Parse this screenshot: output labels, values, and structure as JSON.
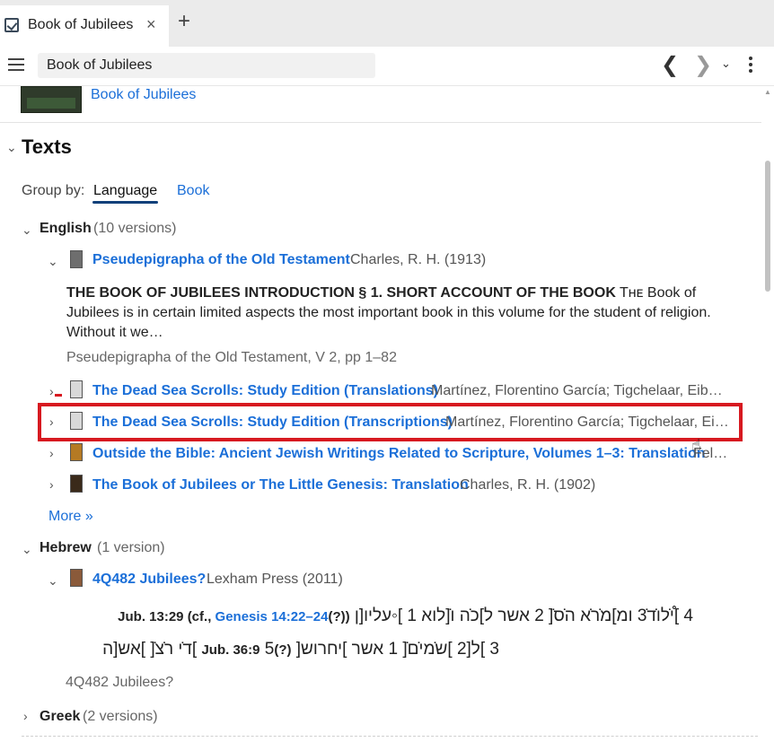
{
  "tab": {
    "title": "Book of Jubilees",
    "close": "×",
    "add": "+"
  },
  "toolbar": {
    "search_value": "Book of Jubilees",
    "back": "❮",
    "forward": "❯",
    "dropdown": "⌄"
  },
  "encyclopedia": {
    "link": "Book of Jubilees"
  },
  "texts": {
    "title": "Texts",
    "group_by_label": "Group by:",
    "group_by_options": [
      "Language",
      "Book"
    ],
    "languages": [
      {
        "name": "English",
        "count": "(10 versions)"
      },
      {
        "name": "Hebrew",
        "count": "(1 version)"
      },
      {
        "name": "Greek",
        "count": "(2 versions)"
      }
    ],
    "english_books": [
      {
        "title": "Pseudepigrapha of the Old Testament",
        "meta": "Charles, R. H. (1913)"
      },
      {
        "title": "The Dead Sea Scrolls: Study Edition (Translations)",
        "meta": "Martínez, Florentino García; Tigchelaar, Eib…"
      },
      {
        "title": "The Dead Sea Scrolls: Study Edition (Transcriptions)",
        "meta": "Martínez, Florentino García; Tigchelaar, Ei…"
      },
      {
        "title": "Outside the Bible: Ancient Jewish Writings Related to Scripture, Volumes 1–3: Translation",
        "meta": "Fel…"
      },
      {
        "title": "The Book of Jubilees or The Little Genesis: Translation",
        "meta": "Charles, R. H. (1902)"
      }
    ],
    "snippet": {
      "heading": "THE BOOK OF JUBILEES INTRODUCTION § 1. SHORT ACCOUNT OF THE BOOK",
      "body": " Tʜᴇ Book of Jubilees is in certain limited aspects the most important book in this volume for the student of religion. Without it we…",
      "citation": "Pseudepigrapha of the Old Testament, V 2, pp 1–82"
    },
    "more": "More »",
    "hebrew_books": [
      {
        "title": "4Q482 Jubilees?",
        "meta": "Lexham Press (2011)"
      }
    ],
    "hebrew_text": {
      "line1_a": "4 ]֯י̇לו̇ד̇3 ומ]מ̇ר̇א ה̇ס̇[ 2 אשר ל]כ̇ה ו̇[לוא 1 ]◦עליו[ן ",
      "line1_ref": "Jub. 13:29 (cf., ",
      "line1_gen": "Genesis 14:22–24",
      "line1_end": "(?))",
      "line2_a": "3 ]ל[2 ]ש̇מי̇ם̇[ 1 אשר ]יחרוש[ ",
      "line2_ref": "(?)Jub. 36:9",
      "line2_b": " 5 ]ד̇י ר̇צ̇[ ]אש[ה",
      "citation": "4Q482 Jubilees?"
    }
  }
}
